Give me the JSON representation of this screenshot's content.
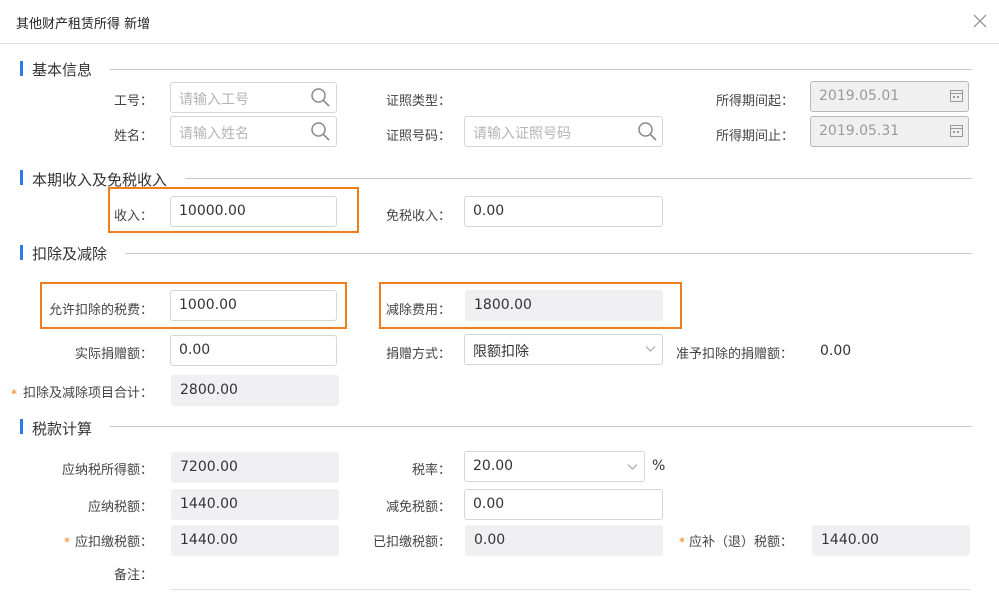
{
  "dialog": {
    "title": "其他财产租赁所得 新增",
    "close_icon": "close-icon"
  },
  "sections": {
    "basic": "基本信息",
    "income": "本期收入及免税收入",
    "deduction": "扣除及减除",
    "tax": "税款计算"
  },
  "basic": {
    "emp_no_label": "工号：",
    "emp_no_placeholder": "请输入工号",
    "name_label": "姓名：",
    "name_placeholder": "请输入姓名",
    "id_type_label": "证照类型：",
    "id_no_label": "证照号码：",
    "id_no_placeholder": "请输入证照号码",
    "period_start_label": "所得期间起：",
    "period_start_value": "2019.05.01",
    "period_end_label": "所得期间止：",
    "period_end_value": "2019.05.31"
  },
  "income": {
    "income_label": "收入：",
    "income_value": "10000.00",
    "exempt_label": "免税收入：",
    "exempt_value": "0.00"
  },
  "deduction": {
    "allowed_tax_label": "允许扣除的税费：",
    "allowed_tax_value": "1000.00",
    "reduction_fee_label": "减除费用：",
    "reduction_fee_value": "1800.00",
    "donation_label": "实际捐赠额：",
    "donation_value": "0.00",
    "donation_method_label": "捐赠方式：",
    "donation_method_value": "限额扣除",
    "allowed_donation_label": "准予扣除的捐赠额：",
    "allowed_donation_value": "0.00",
    "total_label": "扣除及减除项目合计：",
    "total_value": "2800.00"
  },
  "tax": {
    "taxable_income_label": "应纳税所得额：",
    "taxable_income_value": "7200.00",
    "rate_label": "税率：",
    "rate_value": "20.00",
    "rate_unit": "%",
    "tax_payable_label": "应纳税额：",
    "tax_payable_value": "1440.00",
    "tax_relief_label": "减免税额：",
    "tax_relief_value": "0.00",
    "withhold_label": "应扣缴税额：",
    "withhold_value": "1440.00",
    "withheld_label": "已扣缴税额：",
    "withheld_value": "0.00",
    "refund_label": "应补（退）税额：",
    "refund_value": "1440.00",
    "remark_label": "备注："
  },
  "required_mark": "*",
  "colors": {
    "accent": "#2f7ae5",
    "highlight": "#f07d1c",
    "required": "#f07d1c"
  }
}
